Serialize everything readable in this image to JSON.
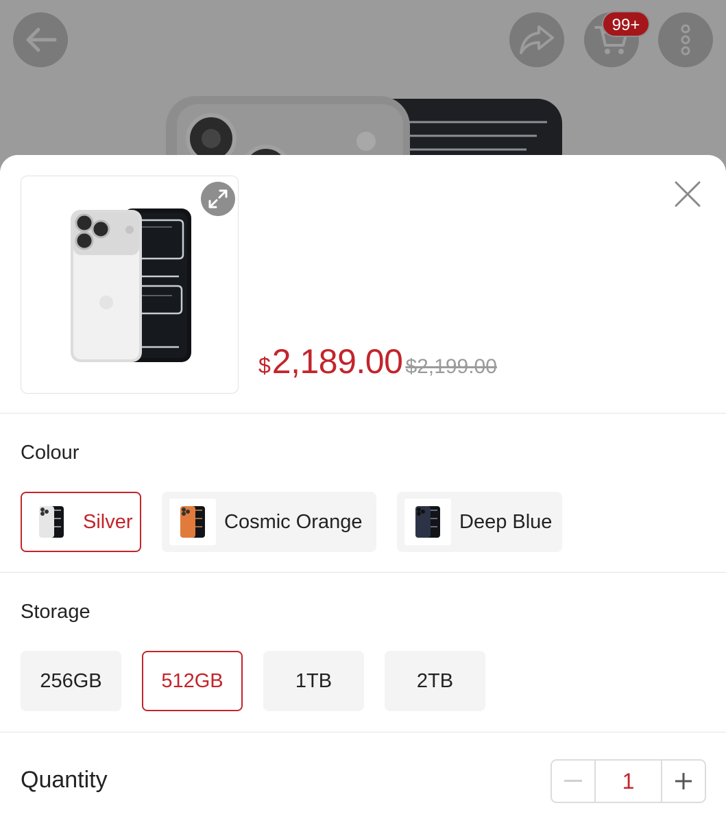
{
  "header": {
    "cart_badge": "99+",
    "icons": [
      "back-arrow-icon",
      "share-icon",
      "cart-icon",
      "more-vertical-icon"
    ]
  },
  "product": {
    "currency": "$",
    "price": "2,189.00",
    "original_price": "$2,199.00",
    "image": "phone-silver"
  },
  "colour": {
    "title": "Colour",
    "options": [
      {
        "label": "Silver",
        "selected": true,
        "swatch": "#e8e8e8"
      },
      {
        "label": "Cosmic Orange",
        "selected": false,
        "swatch": "#e07b3c"
      },
      {
        "label": "Deep Blue",
        "selected": false,
        "swatch": "#2c3346"
      }
    ]
  },
  "storage": {
    "title": "Storage",
    "options": [
      {
        "label": "256GB",
        "selected": false
      },
      {
        "label": "512GB",
        "selected": true
      },
      {
        "label": "1TB",
        "selected": false
      },
      {
        "label": "2TB",
        "selected": false
      }
    ]
  },
  "quantity": {
    "label": "Quantity",
    "value": "1"
  },
  "colors": {
    "accent": "#c3242b",
    "badge": "#a4161a"
  }
}
